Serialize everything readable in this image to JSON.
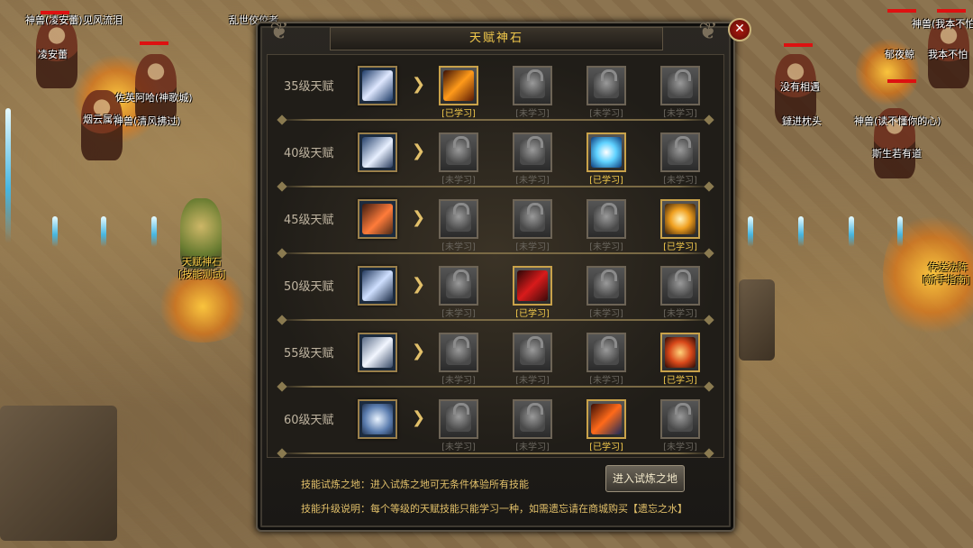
{
  "window": {
    "title": "天赋神石",
    "close_icon": "close-icon",
    "close_symbol": "✕"
  },
  "world": {
    "names": [
      "神兽(凌安蕾)",
      "凌安蕾",
      "见风流泪",
      "乱世佼佼者",
      "神兽(我本不怕)",
      "我本不怕",
      "郁夜鲸",
      "没有相遇",
      "鐽进枕头",
      "神兽(读不懂你的心)",
      "神兽(读不懂你的心)",
      "斯生若有道",
      "烟云属性",
      "神兽(清风拂过)",
      "佐英阿哈(神歌城)",
      "天赋神石",
      "[技能测试]",
      "传送法阵",
      "[新手指南]"
    ]
  },
  "talents": {
    "rows": [
      {
        "level": "35级天赋",
        "skill_icon": "slash-skill-icon",
        "slots": [
          {
            "status": "[已学习]",
            "learned": true,
            "icon": "fire-blade-icon"
          },
          {
            "status": "[未学习]",
            "learned": false,
            "icon": "lock-icon"
          },
          {
            "status": "[未学习]",
            "learned": false,
            "icon": "lock-icon"
          },
          {
            "status": "[未学习]",
            "learned": false,
            "icon": "lock-icon"
          }
        ]
      },
      {
        "level": "40级天赋",
        "skill_icon": "wind-skill-icon",
        "slots": [
          {
            "status": "[未学习]",
            "learned": false,
            "icon": "lock-icon"
          },
          {
            "status": "[未学习]",
            "learned": false,
            "icon": "lock-icon"
          },
          {
            "status": "[已学习]",
            "learned": true,
            "icon": "lightning-icon"
          },
          {
            "status": "[未学习]",
            "learned": false,
            "icon": "lock-icon"
          }
        ]
      },
      {
        "level": "45级天赋",
        "skill_icon": "flame-slash-icon",
        "slots": [
          {
            "status": "[未学习]",
            "learned": false,
            "icon": "lock-icon"
          },
          {
            "status": "[未学习]",
            "learned": false,
            "icon": "lock-icon"
          },
          {
            "status": "[未学习]",
            "learned": false,
            "icon": "lock-icon"
          },
          {
            "status": "[已学习]",
            "learned": true,
            "icon": "golden-arc-icon"
          }
        ]
      },
      {
        "level": "50级天赋",
        "skill_icon": "dash-skill-icon",
        "slots": [
          {
            "status": "[未学习]",
            "learned": false,
            "icon": "lock-icon"
          },
          {
            "status": "[已学习]",
            "learned": true,
            "icon": "blood-strike-icon"
          },
          {
            "status": "[未学习]",
            "learned": false,
            "icon": "lock-icon"
          },
          {
            "status": "[未学习]",
            "learned": false,
            "icon": "lock-icon"
          }
        ]
      },
      {
        "level": "55级天赋",
        "skill_icon": "runner-skill-icon",
        "slots": [
          {
            "status": "[未学习]",
            "learned": false,
            "icon": "lock-icon"
          },
          {
            "status": "[未学习]",
            "learned": false,
            "icon": "lock-icon"
          },
          {
            "status": "[未学习]",
            "learned": false,
            "icon": "lock-icon"
          },
          {
            "status": "[已学习]",
            "learned": true,
            "icon": "fire-burst-icon"
          }
        ]
      },
      {
        "level": "60级天赋",
        "skill_icon": "whirl-skill-icon",
        "slots": [
          {
            "status": "[未学习]",
            "learned": false,
            "icon": "lock-icon"
          },
          {
            "status": "[未学习]",
            "learned": false,
            "icon": "lock-icon"
          },
          {
            "status": "[已学习]",
            "learned": true,
            "icon": "flame-wave-icon"
          },
          {
            "status": "[未学习]",
            "learned": false,
            "icon": "lock-icon"
          }
        ]
      }
    ]
  },
  "footer": {
    "trial_text": "技能试炼之地：进入试炼之地可无条件体验所有技能",
    "upgrade_text": "技能升级说明：每个等级的天赋技能只能学习一种，如需遗忘请在商城购买【遗忘之水】",
    "enter_button": "进入试炼之地"
  },
  "colors": {
    "learned": "#f2c94c",
    "unlearned": "#6a665e",
    "accent": "#e2c06a"
  }
}
